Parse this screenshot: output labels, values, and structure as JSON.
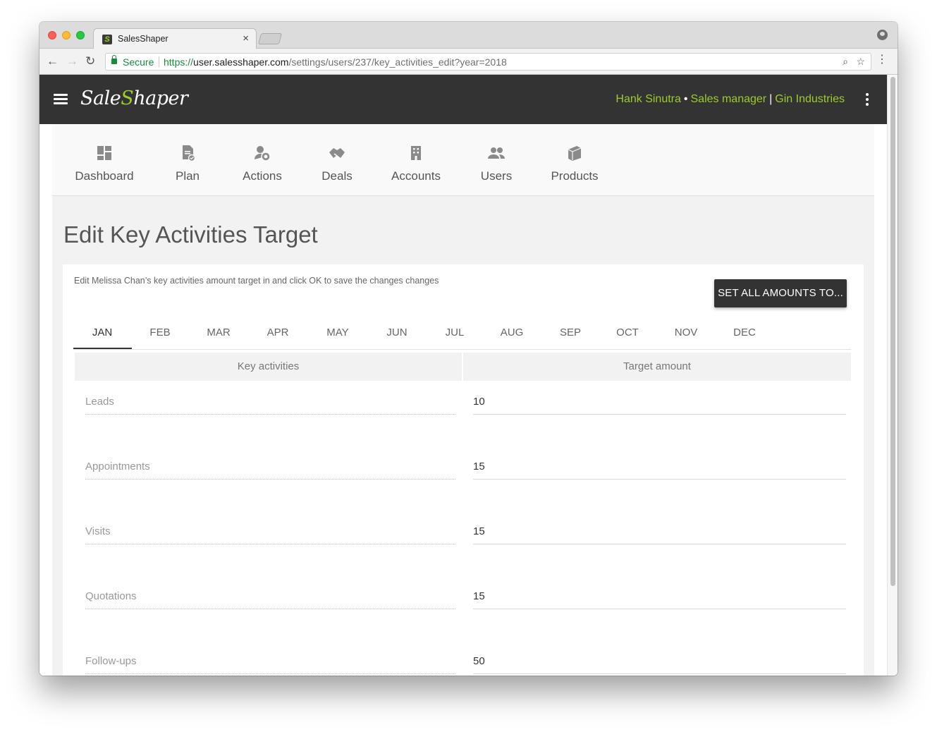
{
  "browser": {
    "tab_title": "SalesShaper",
    "tab_close": "×",
    "secure_label": "Secure",
    "url_scheme": "https://",
    "url_host": "user.salesshaper.com",
    "url_path": "/settings/users/237/key_activities_edit?year=2018"
  },
  "header": {
    "logo_prefix": "Sale",
    "logo_mid": "S",
    "logo_suffix": "haper",
    "user_name": "Hank Sinutra",
    "user_role": "Sales manager",
    "company": "Gin Industries",
    "accent_color": "#9ccc2c"
  },
  "nav": {
    "items": [
      {
        "label": "Dashboard",
        "icon": "dashboard-icon"
      },
      {
        "label": "Plan",
        "icon": "plan-icon"
      },
      {
        "label": "Actions",
        "icon": "actions-icon"
      },
      {
        "label": "Deals",
        "icon": "deals-icon"
      },
      {
        "label": "Accounts",
        "icon": "accounts-icon"
      },
      {
        "label": "Users",
        "icon": "users-icon"
      },
      {
        "label": "Products",
        "icon": "products-icon"
      }
    ]
  },
  "page": {
    "title": "Edit Key Activities Target",
    "description": "Edit Melissa Chan’s key activities amount target in and click OK to save the changes changes",
    "set_all_button": "SET ALL AMOUNTS TO..."
  },
  "months": {
    "active": "JAN",
    "items": [
      "JAN",
      "FEB",
      "MAR",
      "APR",
      "MAY",
      "JUN",
      "JUL",
      "AUG",
      "SEP",
      "OCT",
      "NOV",
      "DEC"
    ]
  },
  "table": {
    "headers": [
      "Key activities",
      "Target amount"
    ],
    "rows": [
      {
        "activity": "Leads",
        "target": "10"
      },
      {
        "activity": "Appointments",
        "target": "15"
      },
      {
        "activity": "Visits",
        "target": "15"
      },
      {
        "activity": "Quotations",
        "target": "15"
      },
      {
        "activity": "Follow-ups",
        "target": "50"
      }
    ]
  }
}
